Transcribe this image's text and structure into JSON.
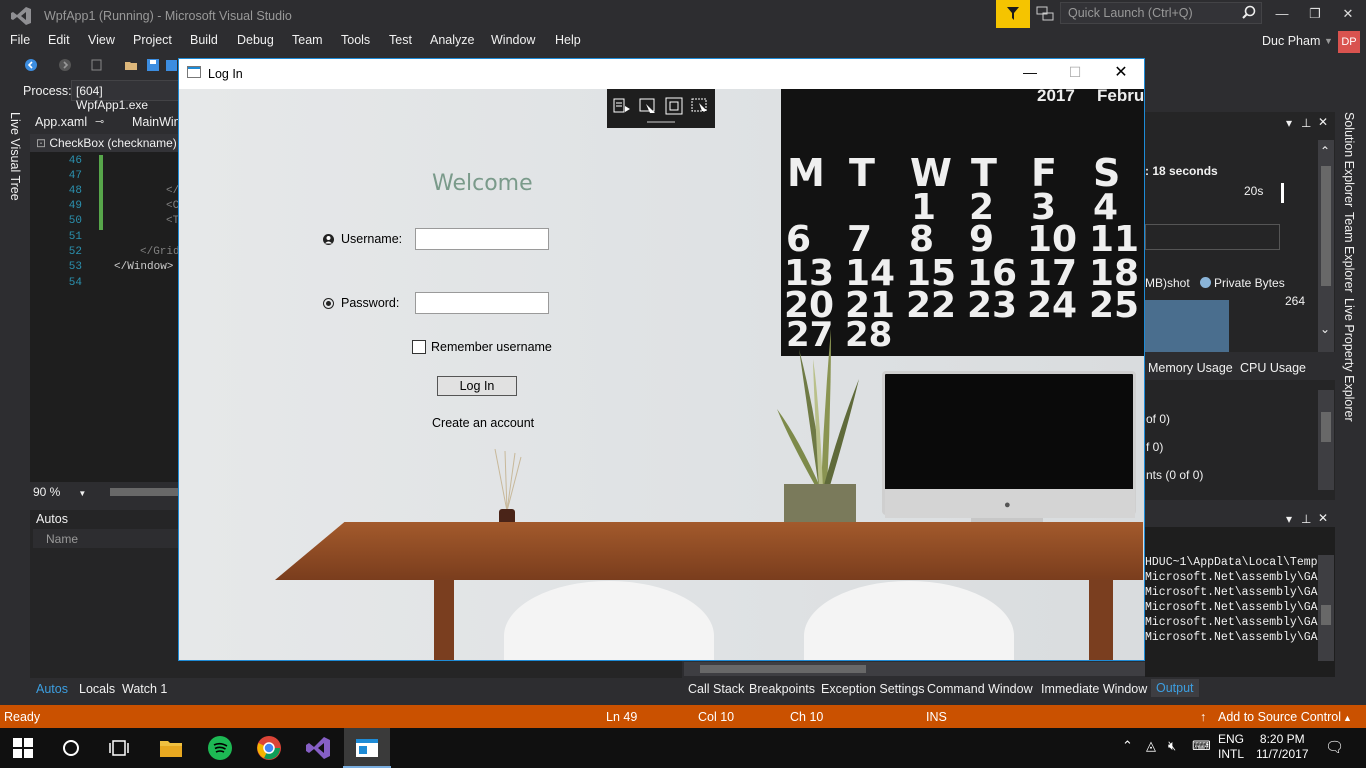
{
  "window": {
    "title": "WpfApp1 (Running) - Microsoft Visual Studio",
    "quick_launch_placeholder": "Quick Launch (Ctrl+Q)",
    "user_name": "Duc Pham",
    "user_initials": "DP"
  },
  "menu": [
    "File",
    "Edit",
    "View",
    "Project",
    "Build",
    "Debug",
    "Team",
    "Tools",
    "Test",
    "Analyze",
    "Window",
    "Help"
  ],
  "toolbar": {
    "process_label": "Process:",
    "process_value": "[604] WpfApp1.exe"
  },
  "left_tabs": {
    "live_visual_tree": "Live Visual Tree"
  },
  "editor": {
    "tabs": [
      "App.xaml",
      "MainWin"
    ],
    "nav_combo": "CheckBox (checkname)",
    "lines": [
      {
        "n": "46",
        "code": ""
      },
      {
        "n": "47",
        "code": ""
      },
      {
        "n": "48",
        "code": "</"
      },
      {
        "n": "49",
        "code": "<C"
      },
      {
        "n": "50",
        "code": "<T"
      },
      {
        "n": "51",
        "code": ""
      },
      {
        "n": "52",
        "code": "</Grid"
      },
      {
        "n": "53",
        "code": "</Window>"
      },
      {
        "n": "54",
        "code": ""
      }
    ],
    "zoom": "90 %"
  },
  "autos": {
    "title": "Autos",
    "name_header": "Name",
    "tabs": [
      "Autos",
      "Locals",
      "Watch 1"
    ]
  },
  "bottom_right_tabs": [
    "Call Stack",
    "Breakpoints",
    "Exception Settings",
    "Command Window",
    "Immediate Window",
    "Output"
  ],
  "diagnostics": {
    "session_text": ": 18 seconds",
    "time_tick": "20s",
    "legend_snapshot": "MB)shot",
    "legend_private": "Private Bytes",
    "value_264": "264",
    "tabs": [
      "Memory Usage",
      "CPU Usage"
    ],
    "events": [
      "of 0)",
      "f 0)",
      "nts (0 of 0)"
    ]
  },
  "output_lines": [
    "HDUC~1\\AppData\\Local\\Temp",
    "Microsoft.Net\\assembly\\GA",
    "Microsoft.Net\\assembly\\GA",
    "Microsoft.Net\\assembly\\GA",
    "Microsoft.Net\\assembly\\GA",
    "Microsoft.Net\\assembly\\GA"
  ],
  "right_tabs": [
    "Solution Explorer",
    "Team Explorer",
    "Live Property Explorer"
  ],
  "status": {
    "ready": "Ready",
    "ln": "Ln 49",
    "col": "Col 10",
    "ch": "Ch 10",
    "ins": "INS",
    "source_control": "Add to Source Control"
  },
  "taskbar": {
    "lang1": "ENG",
    "lang2": "INTL",
    "time": "8:20 PM",
    "date": "11/7/2017"
  },
  "login": {
    "title": "Log In",
    "welcome": "Welcome",
    "username_label": "Username:",
    "password_label": "Password:",
    "username_value": "",
    "password_value": "",
    "remember_label": "Remember username",
    "login_button": "Log In",
    "create_account": "Create an account",
    "calendar_year": "2017",
    "calendar_month": "Febru",
    "calendar_days": [
      "M",
      "T",
      "W",
      "T",
      "F",
      "S"
    ],
    "calendar_numbers": [
      "1",
      "2",
      "3",
      "4",
      "6",
      "7",
      "8",
      "9",
      "10",
      "11",
      "13",
      "14",
      "15",
      "16",
      "17",
      "18",
      "20",
      "21",
      "22",
      "23",
      "24",
      "25",
      "27",
      "28"
    ]
  },
  "colors": {
    "vs_background": "#2d2d30",
    "status_bar": "#ca5100",
    "accent_blue": "#1e8bd6",
    "welcome_text": "#7a9a8a"
  }
}
